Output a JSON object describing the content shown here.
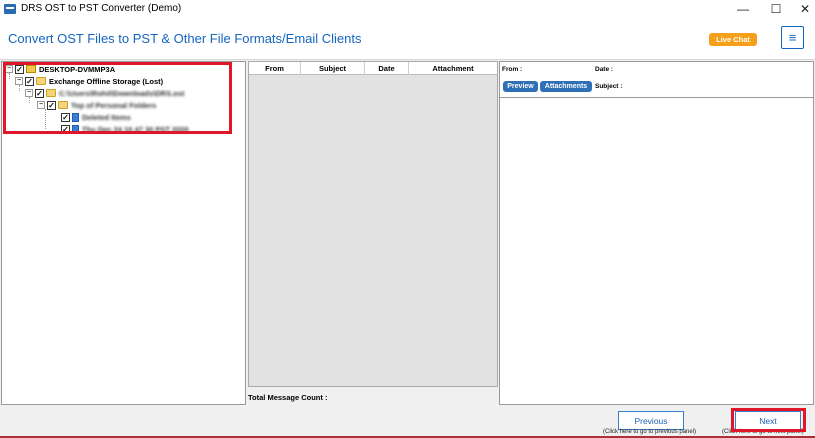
{
  "window": {
    "title": "DRS OST to PST Converter (Demo)",
    "controls": {
      "minimize": "—",
      "maximize": "☐",
      "close": "✕"
    }
  },
  "header": {
    "title": "Convert OST Files to PST & Other File Formats/Email Clients",
    "live_chat_label": "Live Chat",
    "menu_icon": "≡",
    "colors": {
      "accent": "#1565c0",
      "live_chat_bg": "#f6a019"
    }
  },
  "tree": {
    "items": [
      {
        "label": "DESKTOP-DVMMP3A",
        "level": 0,
        "checked": true,
        "icon": "computer-icon"
      },
      {
        "label": "Exchange Offline Storage (Lost)",
        "level": 1,
        "checked": true,
        "icon": "folder-icon"
      },
      {
        "label": "C:\\Users\\Rohit\\Downloads\\DRS.ost",
        "level": 2,
        "checked": true,
        "icon": "folder-icon"
      },
      {
        "label": "Top of Personal Folders",
        "level": 3,
        "checked": true,
        "icon": "folder-icon"
      },
      {
        "label": "Deleted Items",
        "level": 4,
        "checked": true,
        "icon": "mail-folder-icon"
      },
      {
        "label": "Thu Dec 24 10 47 30 PST 2020",
        "level": 4,
        "checked": true,
        "icon": "mail-folder-icon"
      }
    ],
    "expander_symbol": "−",
    "check_symbol": "✓"
  },
  "message_list": {
    "columns": [
      "From",
      "Subject",
      "Date",
      "Attachment"
    ],
    "total_label": "Total Message Count :"
  },
  "preview": {
    "from_label": "From :",
    "date_label": "Date :",
    "subject_label": "Subject :",
    "tabs": [
      "Preview",
      "Attachments"
    ]
  },
  "footer": {
    "previous_label": "Previous",
    "previous_hint": "(Click here to go to previous panel)",
    "next_label": "Next",
    "next_hint": "(Click here to go to next panel)"
  }
}
